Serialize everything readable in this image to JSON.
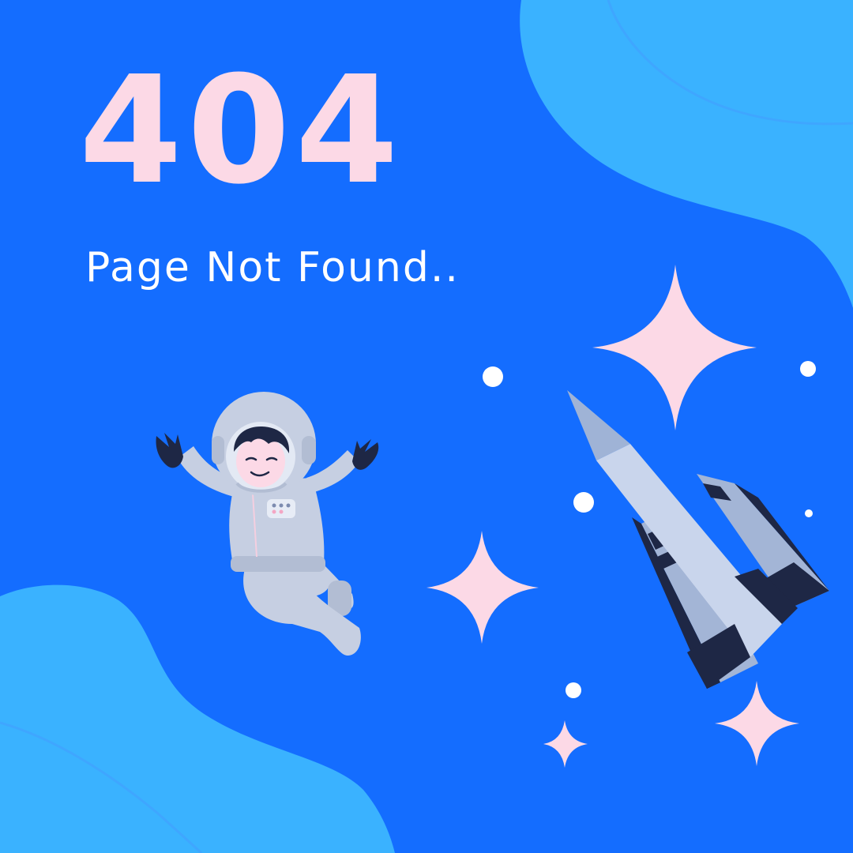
{
  "error_code": "404",
  "message": "Page Not Found..",
  "colors": {
    "background": "#146dff",
    "blob": "#3ab2ff",
    "heading": "#fcd9e6",
    "message": "#ffffff",
    "star": "#fcd9e6",
    "dot": "#ffffff"
  },
  "illustrations": [
    "astronaut-illustration",
    "rocket-illustration",
    "sparkle-star-icon",
    "dot-star-icon"
  ]
}
